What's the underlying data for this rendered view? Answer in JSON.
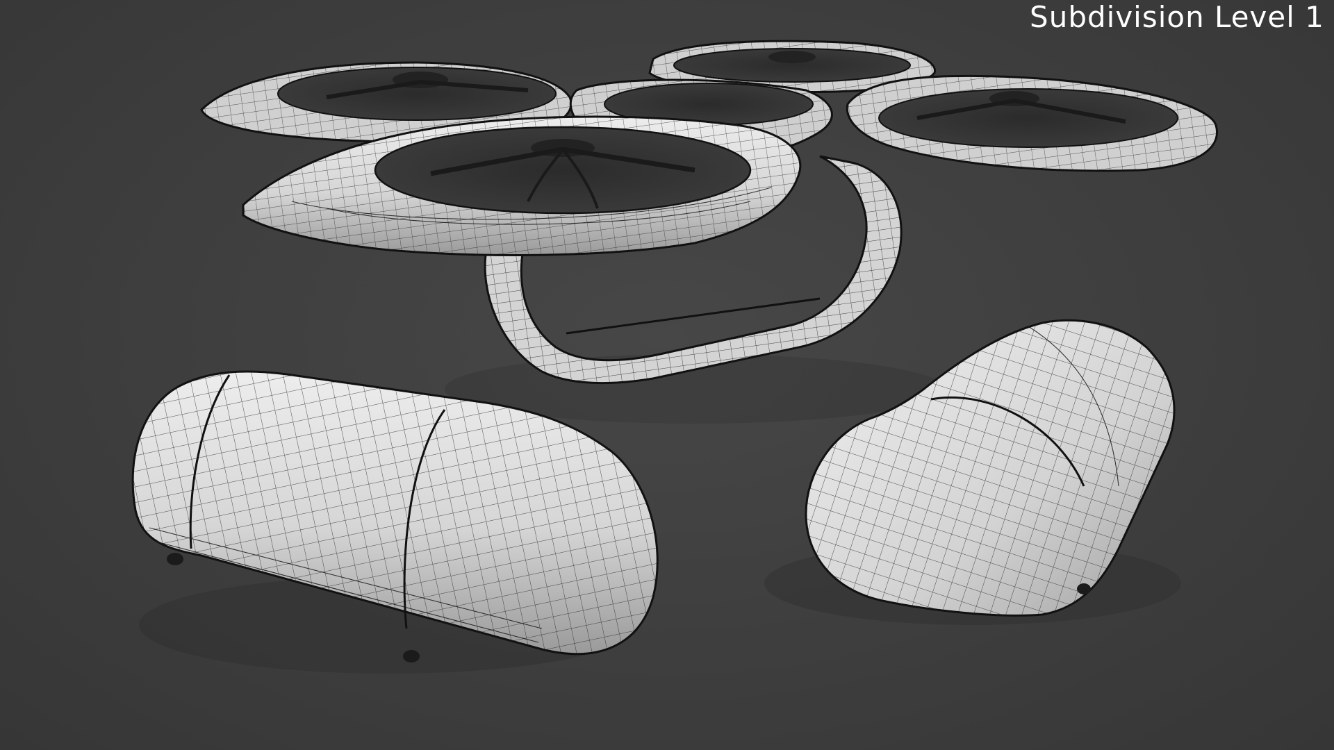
{
  "viewport": {
    "overlay_label": "Subdivision Level 1"
  },
  "colors": {
    "background": "#3f3f3f",
    "mesh_fill": "#d8d8d8",
    "mesh_shadow": "#8a8a8a",
    "wire": "#1a1a1a",
    "label": "#ffffff"
  }
}
